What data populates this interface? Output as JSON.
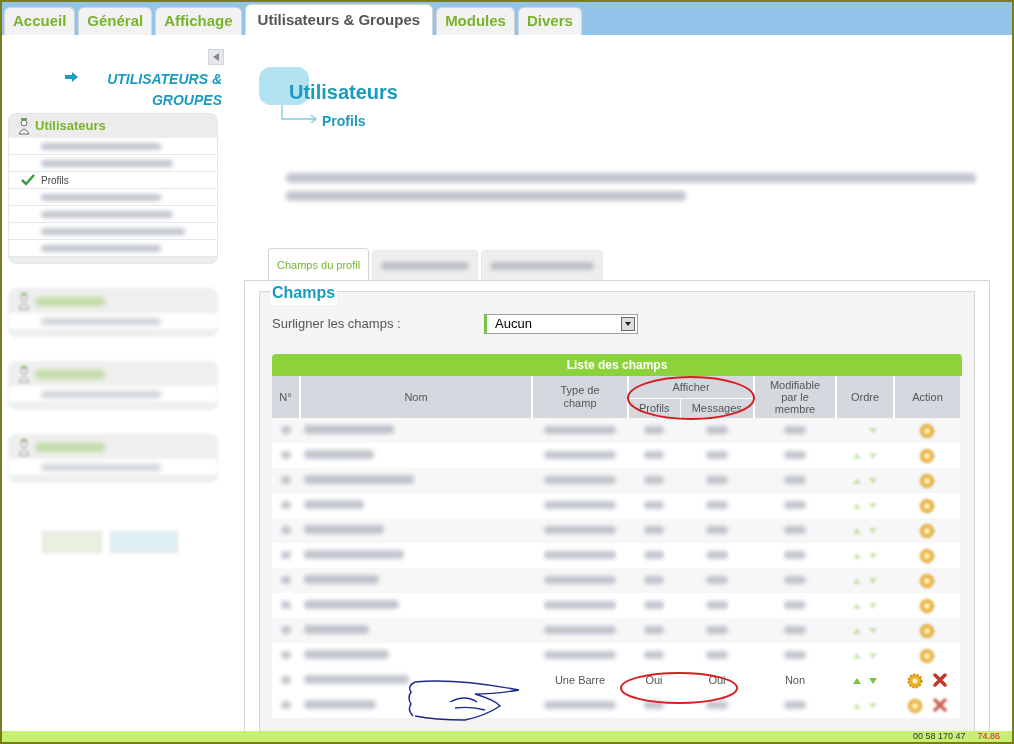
{
  "top_tabs": [
    {
      "label": "Accueil",
      "selected": false
    },
    {
      "label": "Général",
      "selected": false
    },
    {
      "label": "Affichage",
      "selected": false
    },
    {
      "label": "Utilisateurs & Groupes",
      "selected": true
    },
    {
      "label": "Modules",
      "selected": false
    },
    {
      "label": "Divers",
      "selected": false
    }
  ],
  "sidebar": {
    "heading": "UTILISATEURS & GROUPES",
    "menus": [
      {
        "kind": "visible",
        "title": "Utilisateurs",
        "items": [
          {
            "kind": "blurred",
            "selected": false
          },
          {
            "kind": "blurred",
            "selected": false
          },
          {
            "kind": "link",
            "label": "Profils",
            "selected": true
          },
          {
            "kind": "blurred",
            "selected": false
          },
          {
            "kind": "blurred",
            "selected": false
          },
          {
            "kind": "blurred",
            "selected": false
          },
          {
            "kind": "blurred",
            "selected": false
          }
        ]
      },
      {
        "kind": "blurred",
        "items": [
          {
            "kind": "blurred",
            "selected": false
          }
        ]
      },
      {
        "kind": "blurred",
        "items": [
          {
            "kind": "blurred",
            "selected": false
          }
        ]
      },
      {
        "kind": "blurred",
        "items": [
          {
            "kind": "blurred",
            "selected": false
          }
        ]
      }
    ]
  },
  "page": {
    "title": "Utilisateurs",
    "subtitle": "Profils"
  },
  "inner_tabs": [
    {
      "kind": "text",
      "label": "Champs du profil",
      "selected": true
    },
    {
      "kind": "blurred",
      "selected": false
    },
    {
      "kind": "blurred",
      "selected": false
    }
  ],
  "fieldset": {
    "legend": "Champs",
    "highlight_label": "Surligner les champs :",
    "highlight_value": "Aucun"
  },
  "table": {
    "caption": "Liste des champs",
    "columns": {
      "number": "N°",
      "name": "Nom",
      "type": "Type de champ",
      "display": "Afficher",
      "profiles": "Profils",
      "messages": "Messages",
      "editable": "Modifiable par le membre",
      "order": "Ordre",
      "action": "Action"
    },
    "rows": [
      {
        "kind": "blurred",
        "up": false,
        "down": true,
        "delete": false
      },
      {
        "kind": "blurred",
        "up": true,
        "down": true,
        "delete": false
      },
      {
        "kind": "blurred",
        "up": true,
        "down": true,
        "delete": false
      },
      {
        "kind": "blurred",
        "up": true,
        "down": true,
        "delete": false
      },
      {
        "kind": "blurred",
        "up": true,
        "down": true,
        "delete": false
      },
      {
        "kind": "blurred",
        "up": true,
        "down": true,
        "delete": false
      },
      {
        "kind": "blurred",
        "up": true,
        "down": true,
        "delete": false
      },
      {
        "kind": "blurred",
        "up": true,
        "down": true,
        "delete": false
      },
      {
        "kind": "blurred",
        "up": true,
        "down": true,
        "delete": false
      },
      {
        "kind": "blurred",
        "up": true,
        "down": true,
        "delete": false
      },
      {
        "kind": "visible",
        "type": "Une Barre",
        "profiles": "Oui",
        "messages": "Oui",
        "editable": "Non",
        "up": true,
        "down": true,
        "delete": true
      },
      {
        "kind": "blurred",
        "up": true,
        "down": true,
        "delete": true
      }
    ]
  },
  "status_bar": {
    "coords": "00 58 170 47",
    "value": "74.86"
  }
}
